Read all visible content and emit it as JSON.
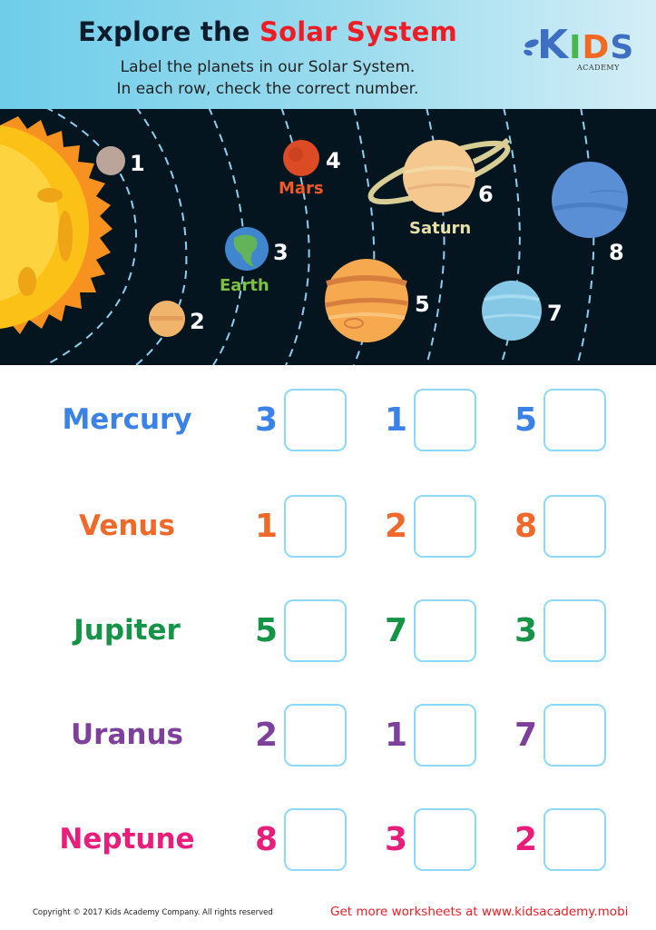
{
  "header": {
    "title_part1": "Explore the ",
    "title_part2": "Solar System",
    "subtitle_line1": "Label the planets in our Solar System.",
    "subtitle_line2": "In each row, check the correct number.",
    "logo": {
      "k": "K",
      "i": "I",
      "d": "D",
      "s": "S",
      "academy": "ACADEMY"
    }
  },
  "diagram": {
    "numbers": [
      "1",
      "2",
      "3",
      "4",
      "5",
      "6",
      "7",
      "8"
    ],
    "labels": {
      "earth": "Earth",
      "mars": "Mars",
      "saturn": "Saturn"
    },
    "colors": {
      "background": "#041520",
      "orbit": "#8dd0ee",
      "earth_label": "#7cc242",
      "mars_label": "#ef5a24",
      "saturn_label": "#e6dfa6"
    }
  },
  "questions": [
    {
      "planet": "Mercury",
      "color": "#3b82e8",
      "options": [
        "3",
        "1",
        "5"
      ]
    },
    {
      "planet": "Venus",
      "color": "#f0692a",
      "options": [
        "1",
        "2",
        "8"
      ]
    },
    {
      "planet": "Jupiter",
      "color": "#159447",
      "options": [
        "5",
        "7",
        "3"
      ]
    },
    {
      "planet": "Uranus",
      "color": "#7d409c",
      "options": [
        "2",
        "1",
        "7"
      ]
    },
    {
      "planet": "Neptune",
      "color": "#e91e7b",
      "options": [
        "8",
        "3",
        "2"
      ]
    }
  ],
  "footer": {
    "copyright": "Copyright © 2017 Kids Academy Company. All rights reserved",
    "promo": "Get more worksheets at www.kidsacademy.mobi"
  }
}
